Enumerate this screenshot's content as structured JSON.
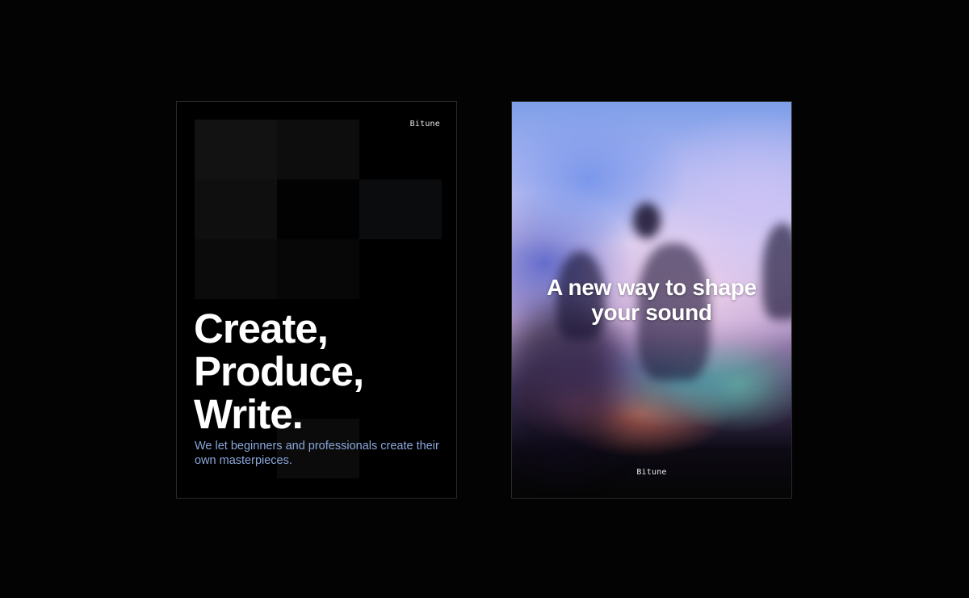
{
  "posters": {
    "left": {
      "brand": "Bitune",
      "headline_lines": [
        "Create,",
        "Produce,",
        "Write."
      ],
      "subtitle": "We let beginners and professionals create their own masterpieces."
    },
    "right": {
      "headline_lines": [
        "A new way to shape",
        "your sound"
      ],
      "brand": "Bitune"
    }
  },
  "colors": {
    "background": "#030303",
    "subtitle_accent": "#8aa8dc",
    "headline": "#ffffff"
  }
}
